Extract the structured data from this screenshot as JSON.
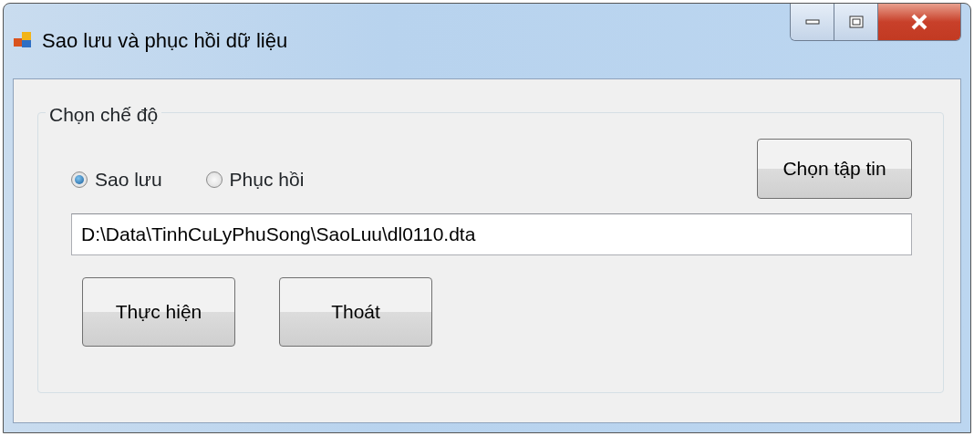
{
  "window": {
    "title": "Sao lưu và phục hồi dữ liệu"
  },
  "group": {
    "title": "Chọn chế độ"
  },
  "modes": [
    {
      "label": "Sao lưu",
      "selected": true
    },
    {
      "label": "Phục hồi",
      "selected": false
    }
  ],
  "choose_file_button": "Chọn tập tin",
  "file_path": {
    "value": "D:\\Data\\TinhCuLyPhuSong\\SaoLuu\\dl0110.dta"
  },
  "buttons": [
    "Thực hiện",
    "Thoát"
  ]
}
